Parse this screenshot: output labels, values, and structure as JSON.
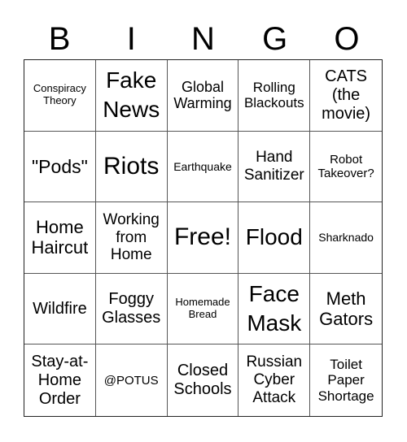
{
  "header": {
    "letters": [
      "B",
      "I",
      "N",
      "G",
      "O"
    ]
  },
  "card": {
    "rows": [
      [
        "Conspiracy\nTheory",
        "Fake\nNews",
        "Global\nWarming",
        "Rolling\nBlackouts",
        "CATS\n(the\nmovie)"
      ],
      [
        "\"Pods\"",
        "Riots",
        "Earthquake",
        "Hand\nSanitizer",
        "Robot\nTakeover?"
      ],
      [
        "Home\nHaircut",
        "Working\nfrom\nHome",
        "Free!",
        "Flood",
        "Sharknado"
      ],
      [
        "Wildfire",
        "Foggy\nGlasses",
        "Homemade\nBread",
        "Face\nMask",
        "Meth\nGators"
      ],
      [
        "Stay-at-\nHome\nOrder",
        "@POTUS",
        "Closed\nSchools",
        "Russian\nCyber\nAttack",
        "Toilet\nPaper\nShortage"
      ]
    ],
    "free_space": "Free!"
  }
}
